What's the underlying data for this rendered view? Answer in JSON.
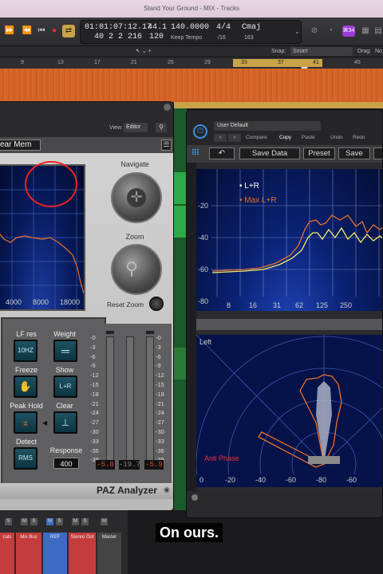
{
  "window": {
    "title": "Stand Your Ground - MIX - Tracks"
  },
  "control_bar": {
    "timecode": "01:01:07:12.17",
    "bars": "40  2  2  216",
    "sample_rate": "44.1",
    "sr_sub": "120",
    "tempo": "140.0000",
    "tempo_label": "Keep Tempo",
    "signature": "4/4",
    "division": "/16",
    "key": "Cmaj",
    "key_sub": "163",
    "badge": "⌘34"
  },
  "snap_bar": {
    "snap_label": "Snap:",
    "snap_value": "Smart",
    "drag_label": "Drag:",
    "drag_value": "No"
  },
  "ruler": {
    "marks": [
      "9",
      "13",
      "17",
      "21",
      "25",
      "29",
      "33",
      "37",
      "41",
      "45"
    ]
  },
  "paz": {
    "view_label": "View:",
    "view_value": "Editor",
    "preset_text": "ear Mem",
    "navigate_label": "Navigate",
    "zoom_label": "Zoom",
    "reset_zoom_label": "Reset Zoom",
    "x_ticks": [
      "4000",
      "8000",
      "18000"
    ],
    "lf_res_label": "LF res",
    "lf_res_value": "10HZ",
    "weight_label": "Weight",
    "freeze_label": "Freeze",
    "show_label": "Show",
    "show_value": "L+R",
    "peak_hold_label": "Peak Hold",
    "clear_label": "Clear",
    "detect_label": "Detect",
    "detect_value": "RMS",
    "response_label": "Response",
    "response_value": "400",
    "meter_scale": [
      "-0",
      "-3",
      "-6",
      "-9",
      "-12",
      "-15",
      "-18",
      "-21",
      "-24",
      "-27",
      "-30",
      "-33",
      "-36",
      "-39"
    ],
    "readouts": [
      "-5.8",
      "-19.7",
      "-5.9"
    ],
    "name": "PAZ Analyzer"
  },
  "waves": {
    "preset": "User Default",
    "compare": "Compare",
    "copy": "Copy",
    "paste": "Paste",
    "undo": "Undo",
    "redo": "Redo",
    "save_data": "Save Data",
    "preset_btn": "Preset",
    "save": "Save",
    "legend_lr": "L+R",
    "legend_max": "Max L+R",
    "y_ticks": [
      "-20",
      "-40",
      "-60",
      "-80"
    ],
    "x_ticks": [
      "8",
      "16",
      "31",
      "62",
      "125",
      "250"
    ],
    "polar_left": "Left",
    "polar_anti": "Anti Phase",
    "polar_ticks": [
      "0",
      "-20",
      "-40",
      "-60",
      "-80",
      "-60"
    ]
  },
  "mixer": {
    "channels": [
      {
        "name": "cals",
        "color": "#c43c3c"
      },
      {
        "name": "Mix Bus",
        "color": "#c43c3c"
      },
      {
        "name": "REF",
        "color": "#3d6bc4"
      },
      {
        "name": "Stereo Out",
        "color": "#c43c3c"
      },
      {
        "name": "Master",
        "color": "#444444"
      }
    ]
  },
  "subtitle": "On ours.",
  "colors": {
    "accent_orange": "#e8702a",
    "lr_yellow": "#f2ea6a",
    "lcd_bg": "#232326"
  }
}
